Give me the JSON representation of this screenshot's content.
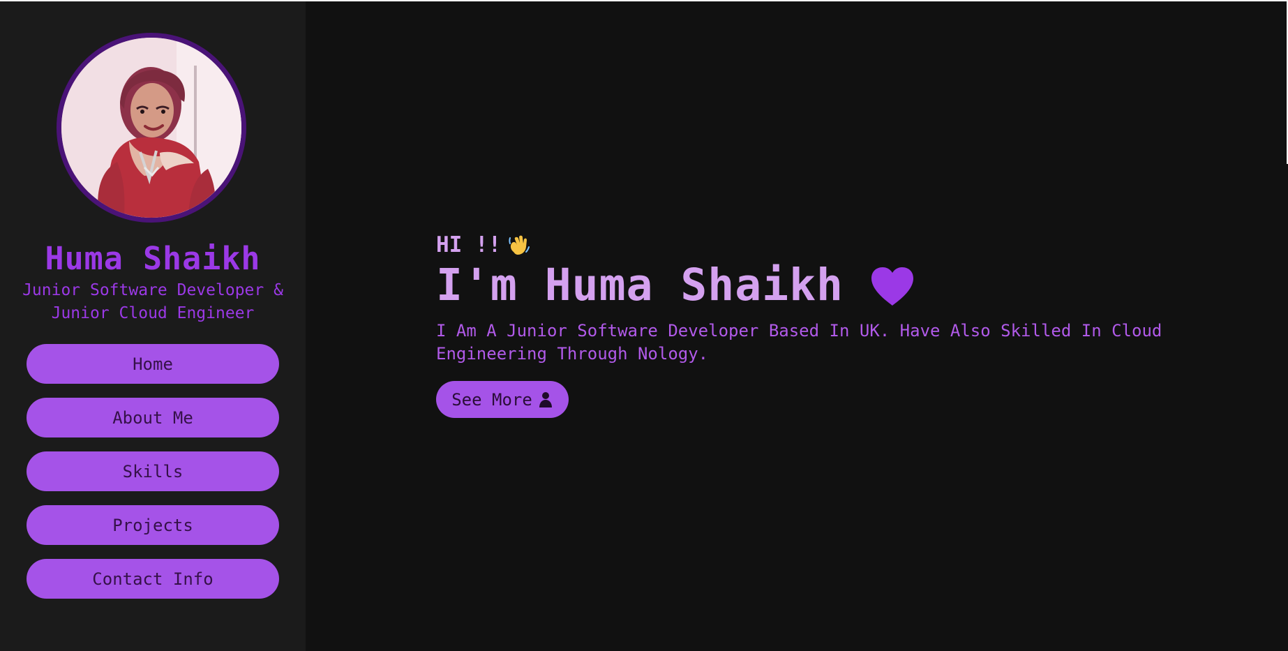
{
  "profile": {
    "name": "Huma Shaikh",
    "role": "Junior Software Developer &\nJunior Cloud Engineer"
  },
  "nav": {
    "items": [
      {
        "label": "Home"
      },
      {
        "label": "About Me"
      },
      {
        "label": "Skills"
      },
      {
        "label": "Projects"
      },
      {
        "label": "Contact Info"
      }
    ]
  },
  "hero": {
    "greeting": "HI !!",
    "title": "I'm Huma Shaikh",
    "description": "I Am A Junior Software Developer Based In UK. Have Also Skilled In Cloud Engineering Through Nology.",
    "button_label": "See More"
  },
  "icons": {
    "greeting": "waving-hand-icon",
    "title": "heart-icon",
    "button": "person-icon"
  },
  "colors": {
    "background": "#111111",
    "sidebar": "#1b1b1b",
    "accent": "#a553e8",
    "heading": "#d4a1ef",
    "text": "#b15ae9",
    "avatar_border": "#4a1377"
  }
}
